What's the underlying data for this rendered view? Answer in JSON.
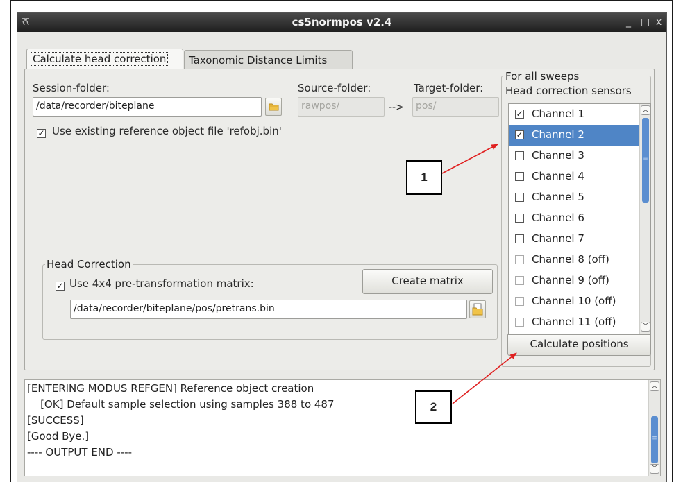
{
  "window": {
    "title": "cs5normpos v2.4",
    "minimize": "_",
    "maximize": "□",
    "close": "x"
  },
  "tabs": [
    {
      "label": "Calculate head correction",
      "active": true
    },
    {
      "label": "Taxonomic Distance Limits",
      "active": false
    }
  ],
  "session": {
    "label": "Session-folder:",
    "value": "/data/recorder/biteplane"
  },
  "source": {
    "label": "Source-folder:",
    "value": "rawpos/"
  },
  "arrow_text": "-->",
  "target": {
    "label": "Target-folder:",
    "value": "pos/"
  },
  "reference": {
    "checked": true,
    "label": "Use existing reference object file 'refobj.bin'"
  },
  "head_correction": {
    "title": "Head Correction",
    "matrix_checked": true,
    "matrix_label": "Use 4x4 pre-transformation matrix:",
    "create_button": "Create matrix",
    "matrix_path": "/data/recorder/biteplane/pos/pretrans.bin"
  },
  "sweeps": {
    "title": "For all sweeps",
    "sensors_label": "Head correction sensors",
    "channels": [
      {
        "label": "Channel 1",
        "checked": true,
        "selected": false,
        "off": false
      },
      {
        "label": "Channel 2",
        "checked": true,
        "selected": true,
        "off": false
      },
      {
        "label": "Channel 3",
        "checked": false,
        "selected": false,
        "off": false
      },
      {
        "label": "Channel 4",
        "checked": false,
        "selected": false,
        "off": false
      },
      {
        "label": "Channel 5",
        "checked": false,
        "selected": false,
        "off": false
      },
      {
        "label": "Channel 6",
        "checked": false,
        "selected": false,
        "off": false
      },
      {
        "label": "Channel 7",
        "checked": false,
        "selected": false,
        "off": false
      },
      {
        "label": "Channel 8 (off)",
        "checked": false,
        "selected": false,
        "off": true
      },
      {
        "label": "Channel 9 (off)",
        "checked": false,
        "selected": false,
        "off": true
      },
      {
        "label": "Channel 10 (off)",
        "checked": false,
        "selected": false,
        "off": true
      },
      {
        "label": "Channel 11 (off)",
        "checked": false,
        "selected": false,
        "off": true
      }
    ],
    "calculate_button": "Calculate positions"
  },
  "output": {
    "lines": [
      "[ENTERING MODUS REFGEN] Reference object creation",
      "    [OK] Default sample selection using samples 388 to 487",
      "[SUCCESS]",
      "[Good Bye.]",
      "---- OUTPUT END ----"
    ]
  },
  "callouts": [
    {
      "label": "1"
    },
    {
      "label": "2"
    }
  ],
  "colors": {
    "selection": "#4f85c6",
    "annotation_arrow": "#e02020",
    "titlebar": "#2a2a2a"
  }
}
